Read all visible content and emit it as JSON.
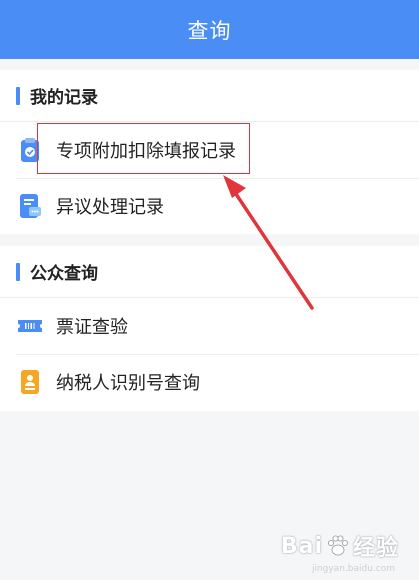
{
  "header": {
    "title": "查询"
  },
  "sections": [
    {
      "title": "我的记录",
      "items": [
        {
          "label": "专项附加扣除填报记录",
          "icon": "clipboard-check-icon"
        },
        {
          "label": "异议处理记录",
          "icon": "document-chat-icon"
        }
      ]
    },
    {
      "title": "公众查询",
      "items": [
        {
          "label": "票证查验",
          "icon": "ticket-icon"
        },
        {
          "label": "纳税人识别号查询",
          "icon": "id-badge-icon"
        }
      ]
    }
  ],
  "colors": {
    "accent": "#4a8ef5",
    "annotation": "#e0363b",
    "icon_orange": "#f5a623"
  },
  "watermark": {
    "text_left": "Bai",
    "text_right": "经验",
    "sub": "jingyan.baidu.com"
  }
}
